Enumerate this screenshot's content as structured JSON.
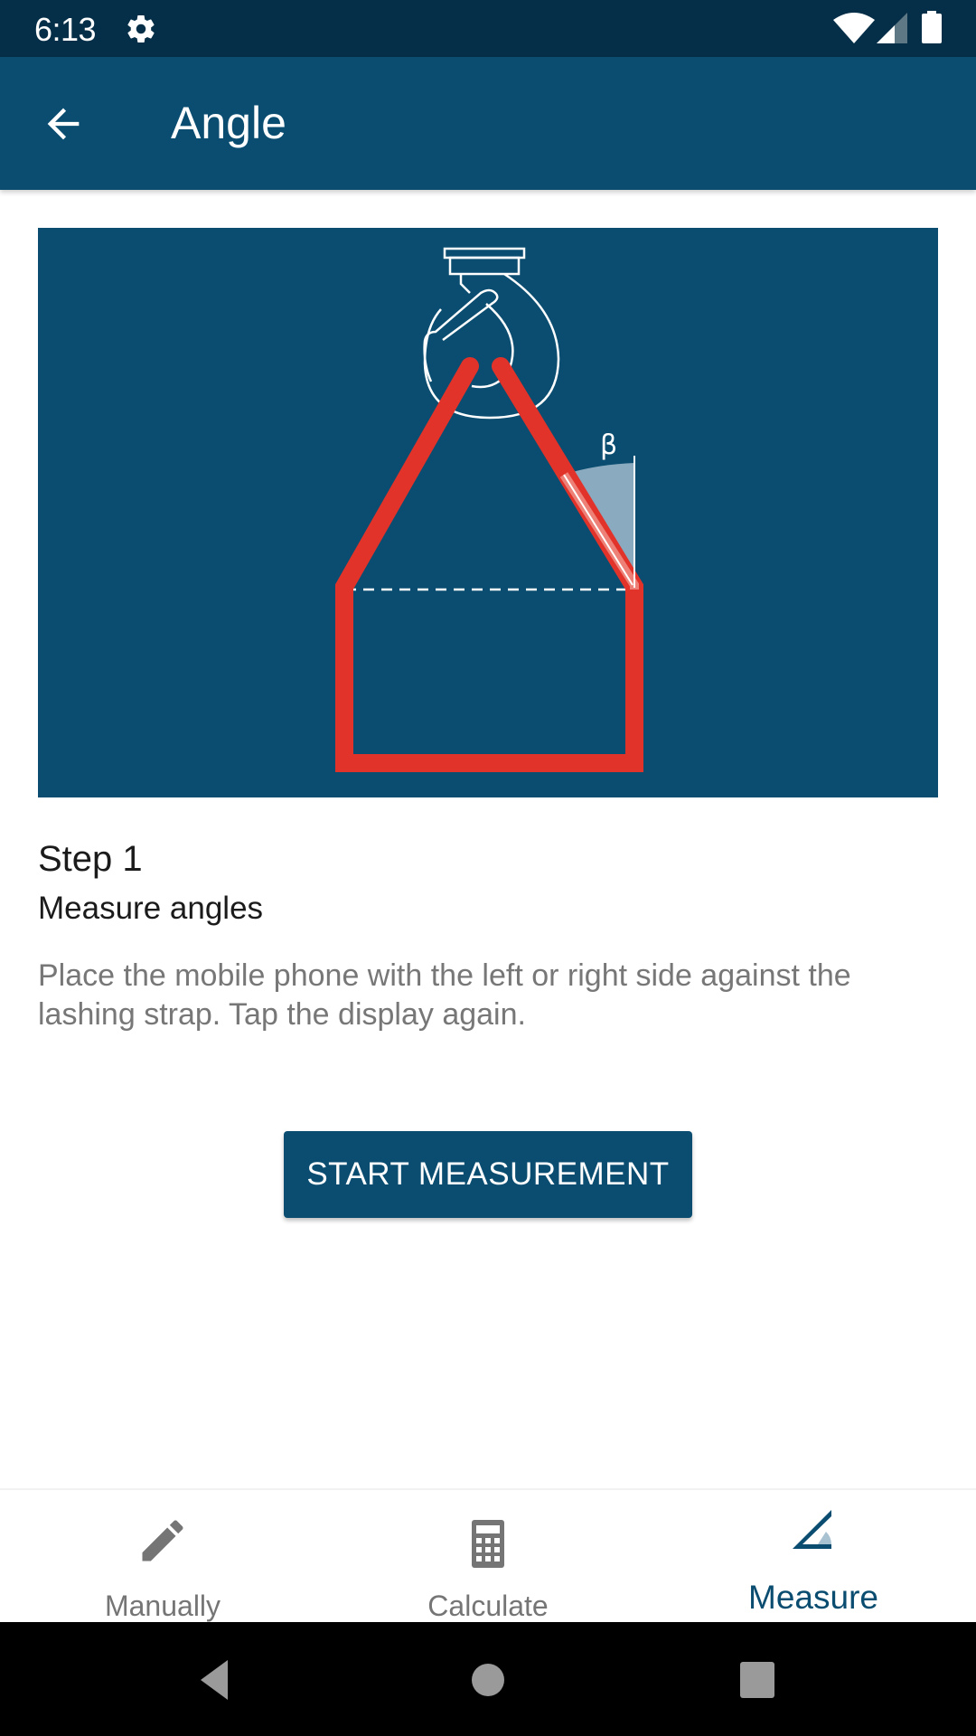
{
  "status_bar": {
    "time": "6:13",
    "icons": [
      "gear-icon",
      "wifi-icon",
      "signal-icon",
      "battery-icon"
    ]
  },
  "app_bar": {
    "title": "Angle",
    "back_icon": "arrow-left-icon"
  },
  "illustration": {
    "angle_symbol": "β",
    "description": "crane hook lifting a load with red lashing straps, angle beta marked",
    "colors": {
      "background": "#0a4d70",
      "strap": "#e2332b",
      "lines": "#ffffff",
      "angle_fill": "#8aaabf"
    }
  },
  "step": {
    "title": "Step 1",
    "subtitle": "Measure angles",
    "description": "Place the mobile phone with the left or right side against the lashing strap. Tap the display again."
  },
  "actions": {
    "start_label": "START MEASUREMENT"
  },
  "bottom_nav": {
    "items": [
      {
        "label": "Manually",
        "icon": "pencil-icon",
        "active": false
      },
      {
        "label": "Calculate",
        "icon": "calculator-icon",
        "active": false
      },
      {
        "label": "Measure",
        "icon": "angle-icon",
        "active": true
      }
    ]
  },
  "system_nav": {
    "buttons": [
      "back",
      "home",
      "recents"
    ]
  },
  "colors": {
    "primary": "#0a4d70",
    "status_bar": "#052f48",
    "inactive": "#757575",
    "accent_red": "#e2332b"
  }
}
